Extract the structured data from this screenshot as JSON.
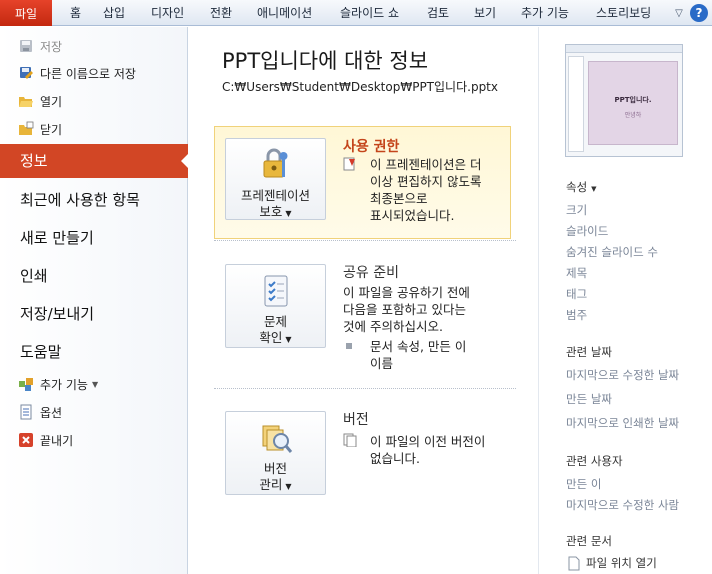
{
  "ribbon": {
    "file_tab": "파일",
    "tabs": [
      "홈",
      "삽입",
      "디자인",
      "전환",
      "애니메이션",
      "슬라이드 쇼",
      "검토",
      "보기",
      "추가 기능",
      "스토리보딩"
    ],
    "help": "?"
  },
  "nav": {
    "save": "저장",
    "save_as": "다른 이름으로 저장",
    "open": "열기",
    "close": "닫기",
    "info": "정보",
    "recent": "최근에 사용한 항목",
    "new": "새로 만들기",
    "print": "인쇄",
    "save_send": "저장/보내기",
    "help": "도움말",
    "addins": "추가 기능",
    "options": "옵션",
    "exit": "끝내기"
  },
  "main": {
    "title": "PPT입니다에 대한 정보",
    "path": "C:₩Users₩Student₩Desktop₩PPT입니다.pptx",
    "permissions": {
      "button_line1": "프레젠테이션",
      "button_line2": "보호",
      "title": "사용 권한",
      "text_lines": [
        "이 프레젠테이션은 더",
        "이상 편집하지 않도록",
        "최종본으로",
        "표시되었습니다."
      ]
    },
    "prepare": {
      "button_line1": "문제",
      "button_line2": "확인",
      "title": "공유 준비",
      "text_lines": [
        "이 파일을 공유하기 전에",
        "다음을 포함하고 있다는",
        "것에 주의하십시오."
      ],
      "bullet_lines": [
        "문서 속성, 만든 이",
        "이름"
      ]
    },
    "versions": {
      "button_line1": "버전",
      "button_line2": "관리",
      "title": "버전",
      "text_lines": [
        "이 파일의 이전 버전이",
        "없습니다."
      ]
    }
  },
  "right": {
    "thumbnail_title": "PPT입니다.",
    "thumbnail_sub": "안녕하",
    "properties_header": "속성",
    "properties": [
      "크기",
      "슬라이드",
      "숨겨진 슬라이드 수",
      "제목",
      "태그",
      "범주"
    ],
    "dates_header": "관련 날짜",
    "dates": [
      "마지막으로 수정한 날짜",
      "만든 날짜",
      "마지막으로 인쇄한 날짜"
    ],
    "people_header": "관련 사용자",
    "people": [
      "만든 이",
      "마지막으로 수정한 사람"
    ],
    "docs_header": "관련 문서",
    "docs": [
      "파일 위치 열기"
    ]
  },
  "colors": {
    "accent": "#d24625",
    "file_tab": "#c3280f",
    "permissions_bg": "#fff7d6",
    "permissions_title": "#c4451b",
    "muted_text": "#7a8597"
  }
}
